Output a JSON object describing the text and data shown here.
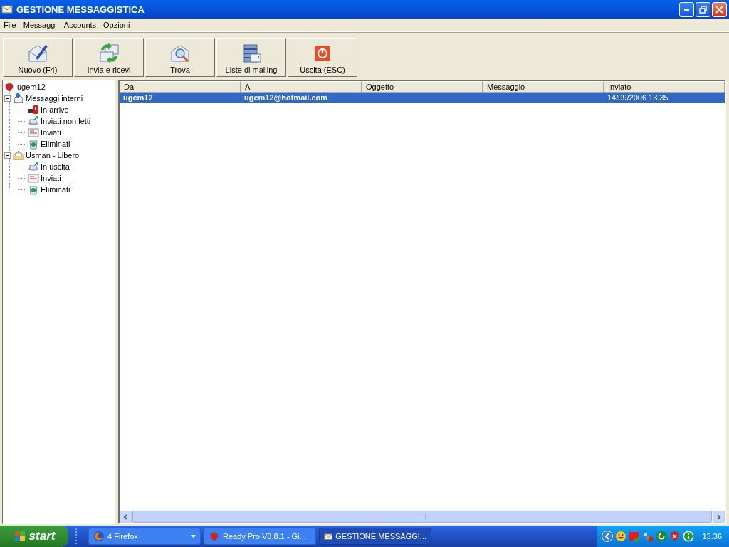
{
  "window": {
    "title": "GESTIONE MESSAGGISTICA"
  },
  "menu": [
    "File",
    "Messaggi",
    "Accounts",
    "Opzioni"
  ],
  "toolbar": [
    {
      "label": "Nuovo (F4)",
      "kind": "compose"
    },
    {
      "label": "Invia e ricevi",
      "kind": "sendreceive"
    },
    {
      "label": "Trova",
      "kind": "find"
    },
    {
      "label": "Liste di mailing",
      "kind": "mailinglist"
    },
    {
      "label": "Uscita (ESC)",
      "kind": "exit"
    }
  ],
  "tree": [
    {
      "label": "ugem12",
      "kind": "user",
      "children": [
        {
          "label": "Messaggi interni",
          "kind": "group",
          "expanded": true,
          "children": [
            {
              "label": "In arrivo",
              "kind": "inbox"
            },
            {
              "label": "Inviati non letti",
              "kind": "outbox"
            },
            {
              "label": "Inviati",
              "kind": "sent"
            },
            {
              "label": "Eliminati",
              "kind": "trash"
            }
          ]
        },
        {
          "label": "Usman - Libero",
          "kind": "account",
          "expanded": true,
          "children": [
            {
              "label": "In uscita",
              "kind": "outbox"
            },
            {
              "label": "Inviati",
              "kind": "sent"
            },
            {
              "label": "Eliminati",
              "kind": "trash"
            }
          ]
        }
      ]
    }
  ],
  "table": {
    "columns": [
      "Da",
      "A",
      "Oggetto",
      "Messaggio",
      "Inviato"
    ],
    "rows": [
      {
        "cells": [
          "ugem12",
          "ugem12@hotmail.com",
          null,
          null,
          "14/09/2006 13.35"
        ],
        "selected": true
      }
    ]
  },
  "taskbar": {
    "start": "start",
    "tasks": [
      {
        "label": "4 Firefox",
        "kind": "firefox",
        "selected": false
      },
      {
        "label": "Ready Pro V8.8.1 - Gi...",
        "kind": "strawberry",
        "selected": false
      },
      {
        "label": "GESTIONE MESSAGGI...",
        "kind": "mail",
        "selected": true
      }
    ],
    "clock": "13.36"
  }
}
